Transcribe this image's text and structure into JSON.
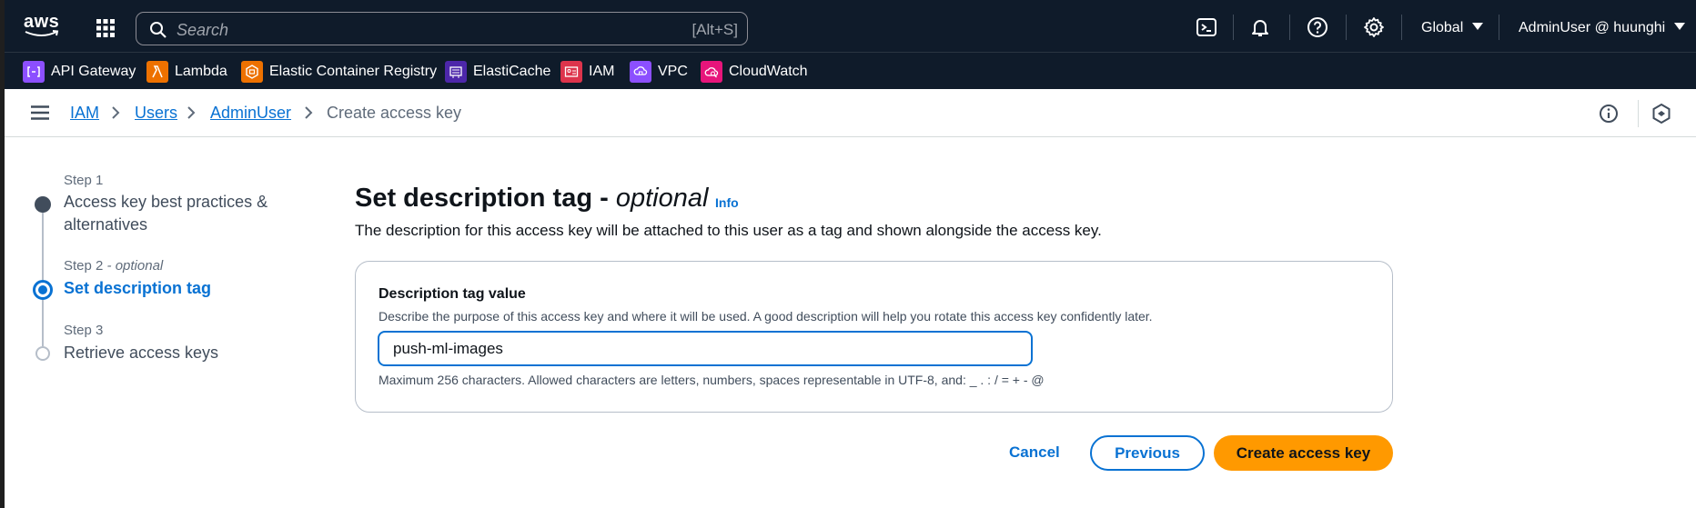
{
  "topnav": {
    "logo_text": "aws",
    "search_placeholder": "Search",
    "search_shortcut": "[Alt+S]",
    "region": "Global",
    "account": "AdminUser @ huunghi",
    "icons": [
      "apps-grid-icon",
      "cloudshell-icon",
      "bell-icon",
      "help-icon",
      "gear-icon"
    ]
  },
  "services": [
    {
      "label": "API Gateway",
      "color": "#8c4fff"
    },
    {
      "label": "Lambda",
      "color": "#ed7100"
    },
    {
      "label": "Elastic Container Registry",
      "color": "#ed7100"
    },
    {
      "label": "ElastiCache",
      "color": "#4d27aa"
    },
    {
      "label": "IAM",
      "color": "#dd344c"
    },
    {
      "label": "VPC",
      "color": "#8c4fff"
    },
    {
      "label": "CloudWatch",
      "color": "#e7157b"
    }
  ],
  "breadcrumb": {
    "items": [
      "IAM",
      "Users",
      "AdminUser"
    ],
    "current": "Create access key"
  },
  "stepper": {
    "steps": [
      {
        "label": "Step 1",
        "title": "Access key best practices & alternatives",
        "state": "done"
      },
      {
        "label": "Step 2",
        "label_suffix": "- optional",
        "title": "Set description tag",
        "state": "active"
      },
      {
        "label": "Step 3",
        "title": "Retrieve access keys",
        "state": "todo"
      }
    ]
  },
  "content": {
    "heading": "Set description tag -",
    "heading_optional": "optional",
    "info_link": "Info",
    "description": "The description for this access key will be attached to this user as a tag and shown alongside the access key.",
    "field": {
      "label": "Description tag value",
      "help": "Describe the purpose of this access key and where it will be used. A good description will help you rotate this access key confidently later.",
      "value": "push-ml-images",
      "constraint": "Maximum 256 characters. Allowed characters are letters, numbers, spaces representable in UTF-8, and: _ . : / = + - @"
    }
  },
  "actions": {
    "cancel": "Cancel",
    "previous": "Previous",
    "create": "Create access key"
  },
  "colors": {
    "nav_bg": "#0f1b2a",
    "link": "#0972d3",
    "primary_button": "#ff9900"
  }
}
